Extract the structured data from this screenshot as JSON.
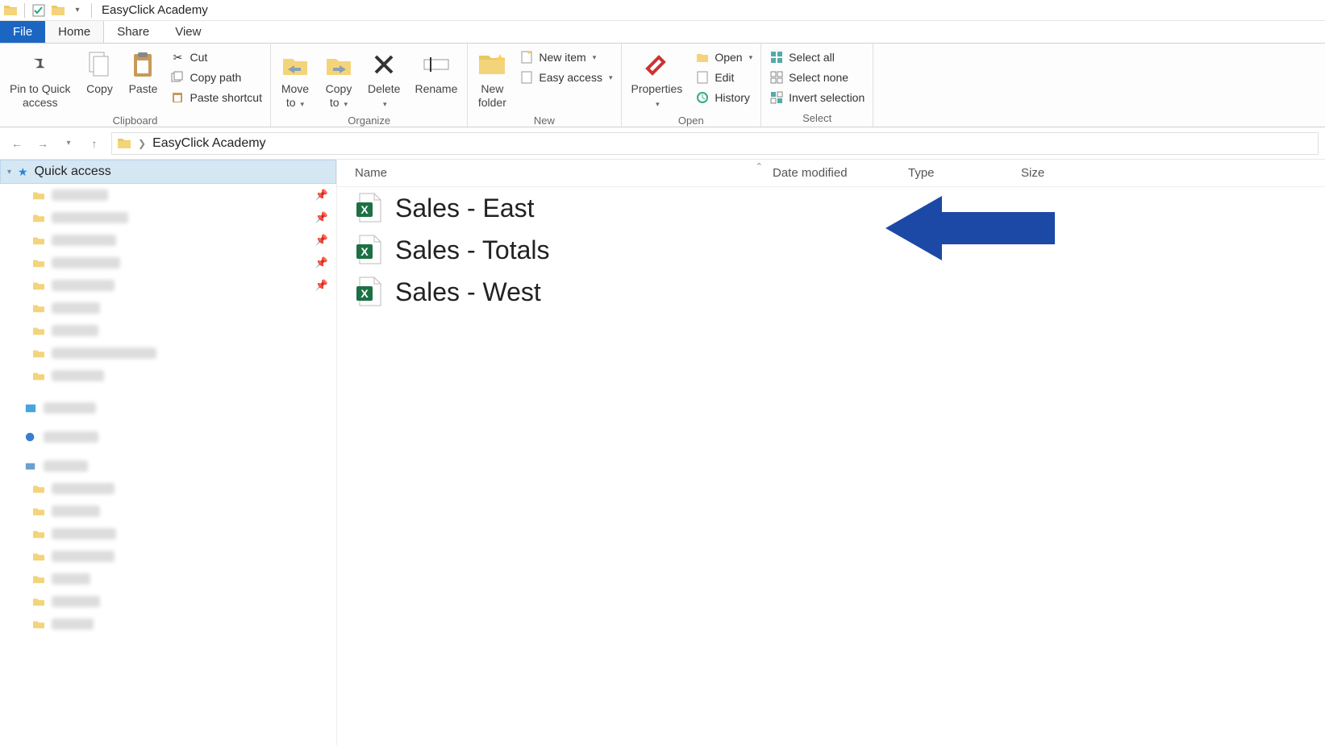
{
  "window": {
    "title": "EasyClick Academy"
  },
  "tabs": {
    "file": "File",
    "home": "Home",
    "share": "Share",
    "view": "View"
  },
  "ribbon": {
    "clipboard": {
      "pin": "Pin to Quick\naccess",
      "copy": "Copy",
      "paste": "Paste",
      "cut": "Cut",
      "copy_path": "Copy path",
      "paste_shortcut": "Paste shortcut",
      "label": "Clipboard"
    },
    "organize": {
      "move_to": "Move\nto",
      "copy_to": "Copy\nto",
      "delete": "Delete",
      "rename": "Rename",
      "label": "Organize"
    },
    "new": {
      "new_folder": "New\nfolder",
      "new_item": "New item",
      "easy_access": "Easy access",
      "label": "New"
    },
    "open": {
      "properties": "Properties",
      "open": "Open",
      "edit": "Edit",
      "history": "History",
      "label": "Open"
    },
    "select": {
      "select_all": "Select all",
      "select_none": "Select none",
      "invert": "Invert selection",
      "label": "Select"
    }
  },
  "breadcrumb": {
    "location": "EasyClick Academy"
  },
  "sidebar": {
    "quick_access": "Quick access"
  },
  "columns": {
    "name": "Name",
    "date": "Date modified",
    "type": "Type",
    "size": "Size"
  },
  "files": [
    {
      "name": "Sales - East"
    },
    {
      "name": "Sales - Totals"
    },
    {
      "name": "Sales - West"
    }
  ]
}
